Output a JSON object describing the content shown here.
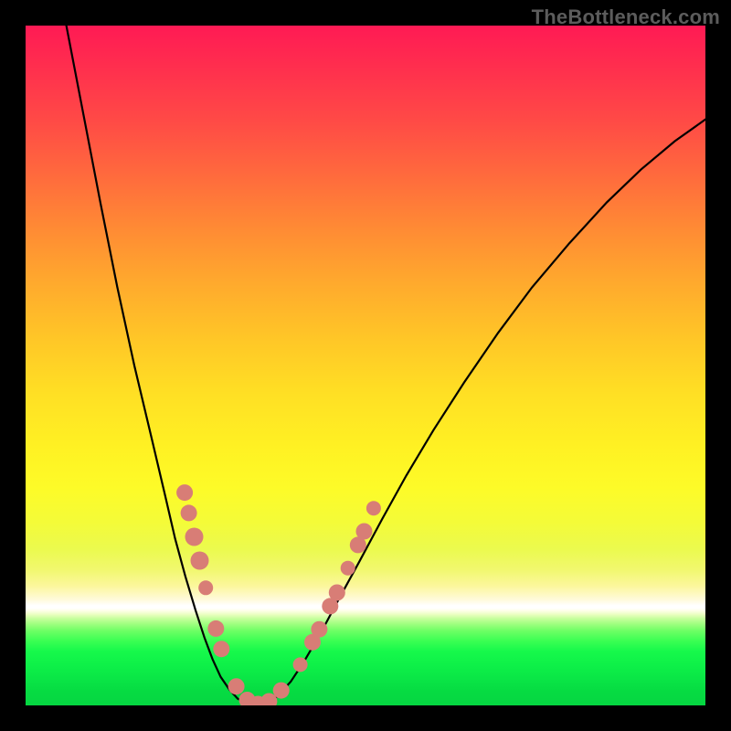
{
  "watermark": "TheBottleneck.com",
  "chart_data": {
    "type": "line",
    "title": "",
    "xlabel": "",
    "ylabel": "",
    "xlim": [
      0,
      1
    ],
    "ylim": [
      0,
      1
    ],
    "curve": {
      "name": "bottleneck-curve",
      "points": [
        {
          "x": 0.06,
          "y": 1.0
        },
        {
          "x": 0.085,
          "y": 0.87
        },
        {
          "x": 0.11,
          "y": 0.74
        },
        {
          "x": 0.135,
          "y": 0.615
        },
        {
          "x": 0.16,
          "y": 0.5
        },
        {
          "x": 0.185,
          "y": 0.395
        },
        {
          "x": 0.205,
          "y": 0.31
        },
        {
          "x": 0.22,
          "y": 0.245
        },
        {
          "x": 0.235,
          "y": 0.19
        },
        {
          "x": 0.25,
          "y": 0.14
        },
        {
          "x": 0.263,
          "y": 0.1
        },
        {
          "x": 0.275,
          "y": 0.068
        },
        {
          "x": 0.287,
          "y": 0.042
        },
        {
          "x": 0.3,
          "y": 0.023
        },
        {
          "x": 0.312,
          "y": 0.01
        },
        {
          "x": 0.325,
          "y": 0.003
        },
        {
          "x": 0.34,
          "y": 0.0
        },
        {
          "x": 0.355,
          "y": 0.003
        },
        {
          "x": 0.37,
          "y": 0.013
        },
        {
          "x": 0.39,
          "y": 0.035
        },
        {
          "x": 0.41,
          "y": 0.065
        },
        {
          "x": 0.435,
          "y": 0.108
        },
        {
          "x": 0.46,
          "y": 0.155
        },
        {
          "x": 0.49,
          "y": 0.21
        },
        {
          "x": 0.525,
          "y": 0.275
        },
        {
          "x": 0.56,
          "y": 0.338
        },
        {
          "x": 0.6,
          "y": 0.405
        },
        {
          "x": 0.645,
          "y": 0.475
        },
        {
          "x": 0.695,
          "y": 0.548
        },
        {
          "x": 0.745,
          "y": 0.615
        },
        {
          "x": 0.8,
          "y": 0.68
        },
        {
          "x": 0.855,
          "y": 0.74
        },
        {
          "x": 0.905,
          "y": 0.788
        },
        {
          "x": 0.955,
          "y": 0.83
        },
        {
          "x": 1.0,
          "y": 0.862
        }
      ]
    },
    "markers": [
      {
        "x": 0.234,
        "y": 0.313,
        "r": 9
      },
      {
        "x": 0.24,
        "y": 0.283,
        "r": 9
      },
      {
        "x": 0.248,
        "y": 0.248,
        "r": 10
      },
      {
        "x": 0.256,
        "y": 0.213,
        "r": 10
      },
      {
        "x": 0.265,
        "y": 0.173,
        "r": 8
      },
      {
        "x": 0.28,
        "y": 0.113,
        "r": 9
      },
      {
        "x": 0.288,
        "y": 0.083,
        "r": 9
      },
      {
        "x": 0.31,
        "y": 0.028,
        "r": 9
      },
      {
        "x": 0.326,
        "y": 0.008,
        "r": 9
      },
      {
        "x": 0.342,
        "y": 0.002,
        "r": 9
      },
      {
        "x": 0.358,
        "y": 0.006,
        "r": 9
      },
      {
        "x": 0.376,
        "y": 0.022,
        "r": 9
      },
      {
        "x": 0.404,
        "y": 0.06,
        "r": 8
      },
      {
        "x": 0.422,
        "y": 0.093,
        "r": 9
      },
      {
        "x": 0.432,
        "y": 0.112,
        "r": 9
      },
      {
        "x": 0.448,
        "y": 0.146,
        "r": 9
      },
      {
        "x": 0.458,
        "y": 0.166,
        "r": 9
      },
      {
        "x": 0.474,
        "y": 0.202,
        "r": 8
      },
      {
        "x": 0.489,
        "y": 0.236,
        "r": 9
      },
      {
        "x": 0.498,
        "y": 0.256,
        "r": 9
      },
      {
        "x": 0.512,
        "y": 0.29,
        "r": 8
      }
    ],
    "gradient_stops_note": "background gradient encodes severity: top=red (high bottleneck) -> yellow -> white band -> green (no bottleneck)"
  }
}
